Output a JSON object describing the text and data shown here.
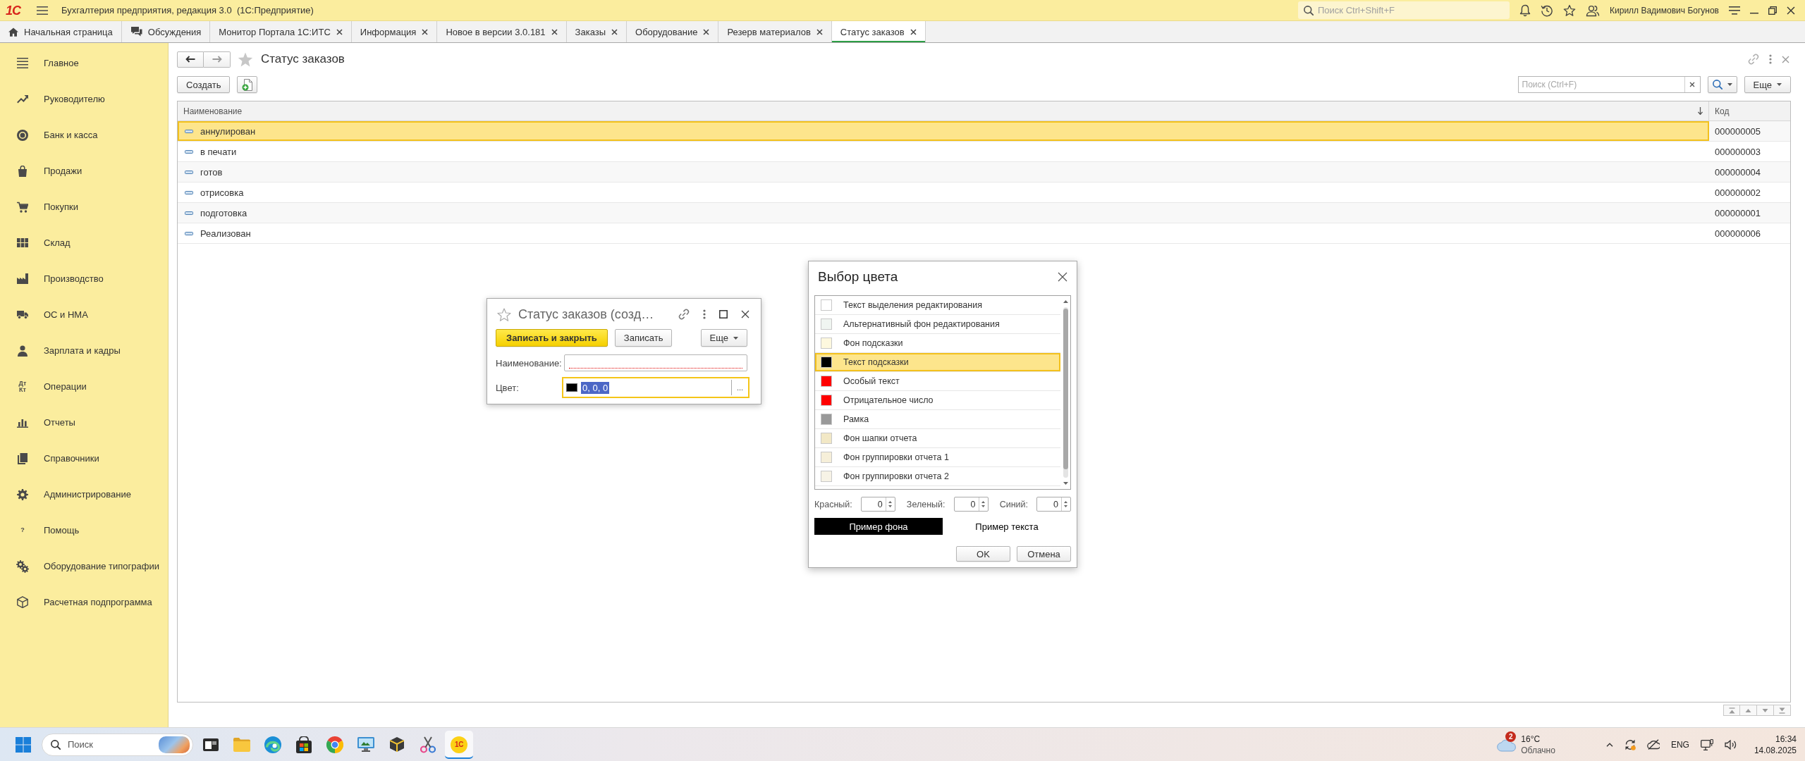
{
  "app_header": {
    "logo": "1С",
    "title": "Бухгалтерия предприятия, редакция 3.0  (1С:Предприятие)",
    "search": {
      "placeholder": "Поиск Ctrl+Shift+F"
    },
    "user": "Кирилл Вадимович Богунов"
  },
  "tabs": [
    {
      "label": "Начальная страница",
      "kind": "home",
      "selected": false
    },
    {
      "label": "Обсуждения",
      "kind": "discussions",
      "selected": false
    },
    {
      "label": "Монитор Портала 1С:ИТС",
      "kind": "document",
      "selected": false
    },
    {
      "label": "Информация",
      "kind": "document",
      "selected": false
    },
    {
      "label": "Новое в версии 3.0.181",
      "kind": "document",
      "selected": false
    },
    {
      "label": "Заказы",
      "kind": "document",
      "selected": false
    },
    {
      "label": "Оборудование",
      "kind": "document",
      "selected": false
    },
    {
      "label": "Резерв материалов",
      "kind": "document",
      "selected": false
    },
    {
      "label": "Статус заказов",
      "kind": "document",
      "selected": true
    }
  ],
  "sidebar": {
    "items": [
      {
        "label": "Главное"
      },
      {
        "label": "Руководителю"
      },
      {
        "label": "Банк и касса"
      },
      {
        "label": "Продажи"
      },
      {
        "label": "Покупки"
      },
      {
        "label": "Склад"
      },
      {
        "label": "Производство"
      },
      {
        "label": "ОС и НМА"
      },
      {
        "label": "Зарплата и кадры"
      },
      {
        "label": "Операции",
        "icon_text": "Дт Кт"
      },
      {
        "label": "Отчеты"
      },
      {
        "label": "Справочники"
      },
      {
        "label": "Администрирование"
      },
      {
        "label": "Помощь",
        "icon_text": "?"
      },
      {
        "label": "Оборудование типографии"
      },
      {
        "label": "Расчетная подпрограмма"
      }
    ]
  },
  "form": {
    "title": "Статус заказов",
    "create_button": "Создать",
    "search": {
      "placeholder": "Поиск (Ctrl+F)"
    },
    "more_button": "Еще",
    "table": {
      "columns": [
        "Наименование",
        "Код"
      ],
      "rows": [
        {
          "name": "аннулирован",
          "code": "000000005",
          "selected": true
        },
        {
          "name": "в печати",
          "code": "000000003",
          "selected": false
        },
        {
          "name": "готов",
          "code": "000000004",
          "selected": false
        },
        {
          "name": "отрисовка",
          "code": "000000002",
          "selected": false
        },
        {
          "name": "подготовка",
          "code": "000000001",
          "selected": false
        },
        {
          "name": "Реализован",
          "code": "000000006",
          "selected": false
        }
      ]
    }
  },
  "record_dialog": {
    "title": "Статус заказов (созд…",
    "buttons": [
      {
        "label": "Записать и закрыть",
        "kind": "primary"
      },
      {
        "label": "Записать",
        "kind": "normal"
      }
    ],
    "more_button": "Еще",
    "fields": [
      {
        "label": "Наименование:",
        "kind": "text",
        "required": true,
        "focused": false
      },
      {
        "label": "Цвет:",
        "kind": "color",
        "value": "0, 0, 0",
        "color": "#000000",
        "choose_button": "...",
        "required": false,
        "focused": true
      }
    ]
  },
  "color_dialog": {
    "title": "Выбор цвета",
    "items": [
      {
        "label": "Текст выделения редактирования",
        "color": "#ffffff",
        "selected": false
      },
      {
        "label": "Альтернативный фон редактирования",
        "color": "#f0f5f1",
        "selected": false
      },
      {
        "label": "Фон подсказки",
        "color": "#fdf8de",
        "selected": false
      },
      {
        "label": "Текст подсказки",
        "color": "#000000",
        "selected": true
      },
      {
        "label": "Особый текст",
        "color": "#ff0000",
        "selected": false
      },
      {
        "label": "Отрицательное число",
        "color": "#ff0000",
        "selected": false
      },
      {
        "label": "Рамка",
        "color": "#999999",
        "selected": false
      },
      {
        "label": "Фон шапки отчета",
        "color": "#f2e8c6",
        "selected": false
      },
      {
        "label": "Фон группировки отчета 1",
        "color": "#f6efd9",
        "selected": false
      },
      {
        "label": "Фон группировки отчета 2",
        "color": "#f7f3e6",
        "selected": false
      }
    ],
    "channels": [
      {
        "label": "Красный:",
        "value": "0"
      },
      {
        "label": "Зеленый:",
        "value": "0"
      },
      {
        "label": "Синий:",
        "value": "0"
      }
    ],
    "background_sample": "Пример фона",
    "text_sample": "Пример текста",
    "buttons": [
      "OK",
      "Отмена"
    ]
  },
  "taskbar": {
    "search": {
      "placeholder": "Поиск"
    },
    "apps": [
      {
        "selected": false
      },
      {
        "selected": false
      },
      {
        "selected": false
      },
      {
        "selected": false
      },
      {
        "selected": false
      },
      {
        "selected": false
      },
      {
        "selected": false
      },
      {
        "selected": false
      },
      {
        "label": "1С",
        "selected": true
      }
    ],
    "weather": {
      "badge": "2",
      "temperature": "16°C",
      "condition": "Облачно"
    },
    "language": "ENG",
    "time": "16:34",
    "date": "14.08.2025"
  }
}
